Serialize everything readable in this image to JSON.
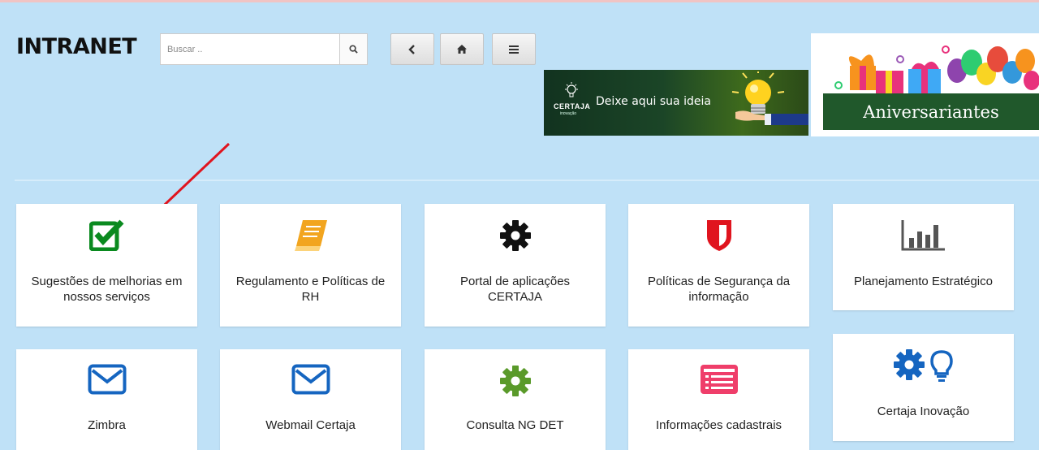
{
  "brand": {
    "title": "INTRANET"
  },
  "search": {
    "placeholder": "Buscar ..",
    "button_icon": "search-icon"
  },
  "nav": {
    "back_icon": "chevron-left-icon",
    "home_icon": "home-icon",
    "menu_icon": "hamburger-menu-icon"
  },
  "banners": {
    "idea": {
      "logo": "CERTAJA",
      "logo_sub": "inovação",
      "text": "Deixe aqui sua ideia"
    },
    "birthday": {
      "text": "Aniversariantes"
    }
  },
  "tiles": {
    "sugestoes": {
      "label": "Sugestões de melhorias em nossos serviços",
      "icon": "checkbox-icon",
      "color": "#0a8a1f"
    },
    "regulamento": {
      "label": "Regulamento e Políticas de RH",
      "icon": "book-icon",
      "color": "#f2a51f"
    },
    "portal": {
      "label": "Portal de aplicações CERTAJA",
      "icon": "gear-icon",
      "color": "#111111"
    },
    "seguranca": {
      "label": "Políticas de Segurança da informação",
      "icon": "shield-icon",
      "color": "#e0141e"
    },
    "planejamento": {
      "label": "Planejamento Estratégico",
      "icon": "bar-chart-icon",
      "color": "#555555"
    },
    "zimbra": {
      "label": "Zimbra",
      "icon": "envelope-icon",
      "color": "#1565c0"
    },
    "webmail": {
      "label": "Webmail Certaja",
      "icon": "envelope-icon",
      "color": "#1565c0"
    },
    "consulta": {
      "label": "Consulta NG DET",
      "icon": "gear-icon",
      "color": "#5a9a2a"
    },
    "informacoes": {
      "label": "Informações cadastrais",
      "icon": "list-card-icon",
      "color": "#ef3e6a"
    },
    "inovacao": {
      "label": "Certaja Inovação",
      "icon": "gear-lightbulb-icon",
      "color": "#1565c0"
    }
  },
  "annotation": {
    "icon": "red-arrow-icon",
    "color": "#e0141e"
  }
}
